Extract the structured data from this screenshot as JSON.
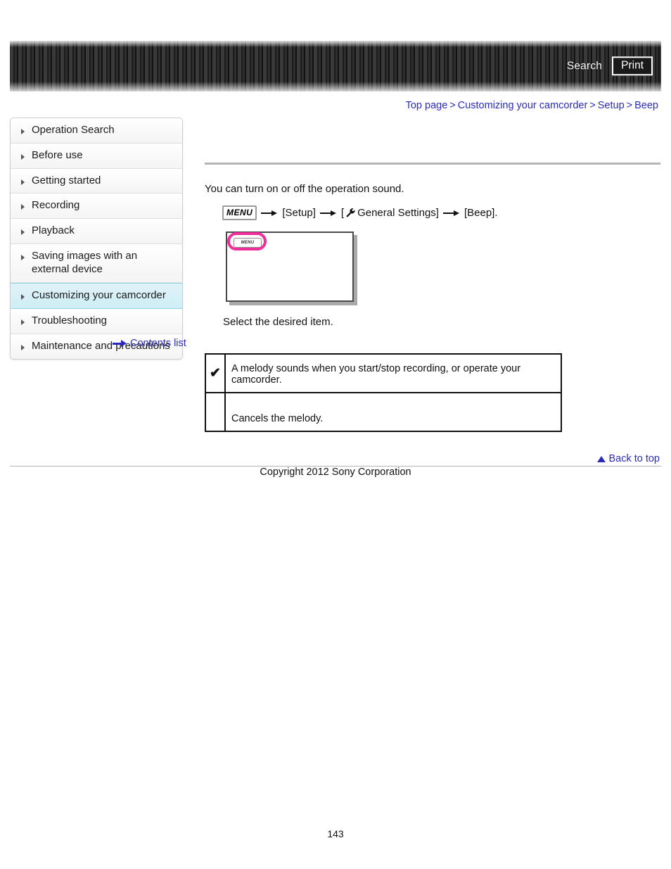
{
  "header": {
    "search_label": "Search",
    "print_label": "Print"
  },
  "breadcrumb": {
    "items": [
      {
        "label": "Top page"
      },
      {
        "label": "Customizing your camcorder"
      },
      {
        "label": "Setup"
      },
      {
        "label": "Beep"
      }
    ],
    "separator": ">"
  },
  "sidebar": {
    "items": [
      {
        "label": "Operation Search",
        "active": false
      },
      {
        "label": "Before use",
        "active": false
      },
      {
        "label": "Getting started",
        "active": false
      },
      {
        "label": "Recording",
        "active": false
      },
      {
        "label": "Playback",
        "active": false
      },
      {
        "label": "Saving images with an external device",
        "active": false
      },
      {
        "label": "Customizing your camcorder",
        "active": true
      },
      {
        "label": "Troubleshooting",
        "active": false
      },
      {
        "label": "Maintenance and precautions",
        "active": false
      }
    ],
    "contents_list_label": "Contents list"
  },
  "main": {
    "intro": "You can turn on or off the operation sound.",
    "menu_path": {
      "menu_badge": "MENU",
      "step1": "[Setup]",
      "step2_prefix": "[",
      "step2": "General Settings]",
      "step3": "[Beep]."
    },
    "screen_figure": {
      "menu_button_label": "MENU",
      "highlight_color": "#f0309a"
    },
    "select_instruction": "Select the desired item.",
    "options_table": {
      "rows": [
        {
          "mark": "✔",
          "description": "A melody sounds when you start/stop recording, or operate your camcorder."
        },
        {
          "mark": "",
          "description": "Cancels the melody."
        }
      ]
    }
  },
  "footer": {
    "back_to_top_label": "Back to top",
    "copyright": "Copyright 2012 Sony Corporation",
    "page_number": "143"
  }
}
